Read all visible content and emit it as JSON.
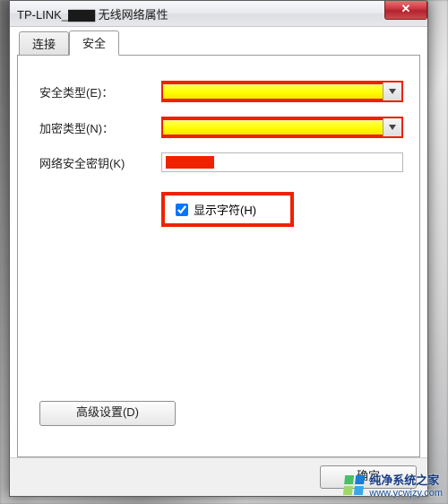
{
  "window": {
    "title": "TP-LINK_▇▇▇ 无线网络属性"
  },
  "tabs": {
    "connect": {
      "label": "连接"
    },
    "security": {
      "label": "安全"
    }
  },
  "form": {
    "security_type": {
      "label": "安全类型(E)：",
      "value": ""
    },
    "encryption_type": {
      "label": "加密类型(N)：",
      "value": ""
    },
    "security_key": {
      "label": "网络安全密钥(K)",
      "value": ""
    },
    "show_chars": {
      "label": "显示字符(H)",
      "checked": true
    }
  },
  "advanced_button": {
    "label": "高级设置(D)"
  },
  "buttons": {
    "ok": "确定"
  },
  "watermark": {
    "site": "纯净系统之家",
    "url": "www.ycwjzy.com"
  }
}
